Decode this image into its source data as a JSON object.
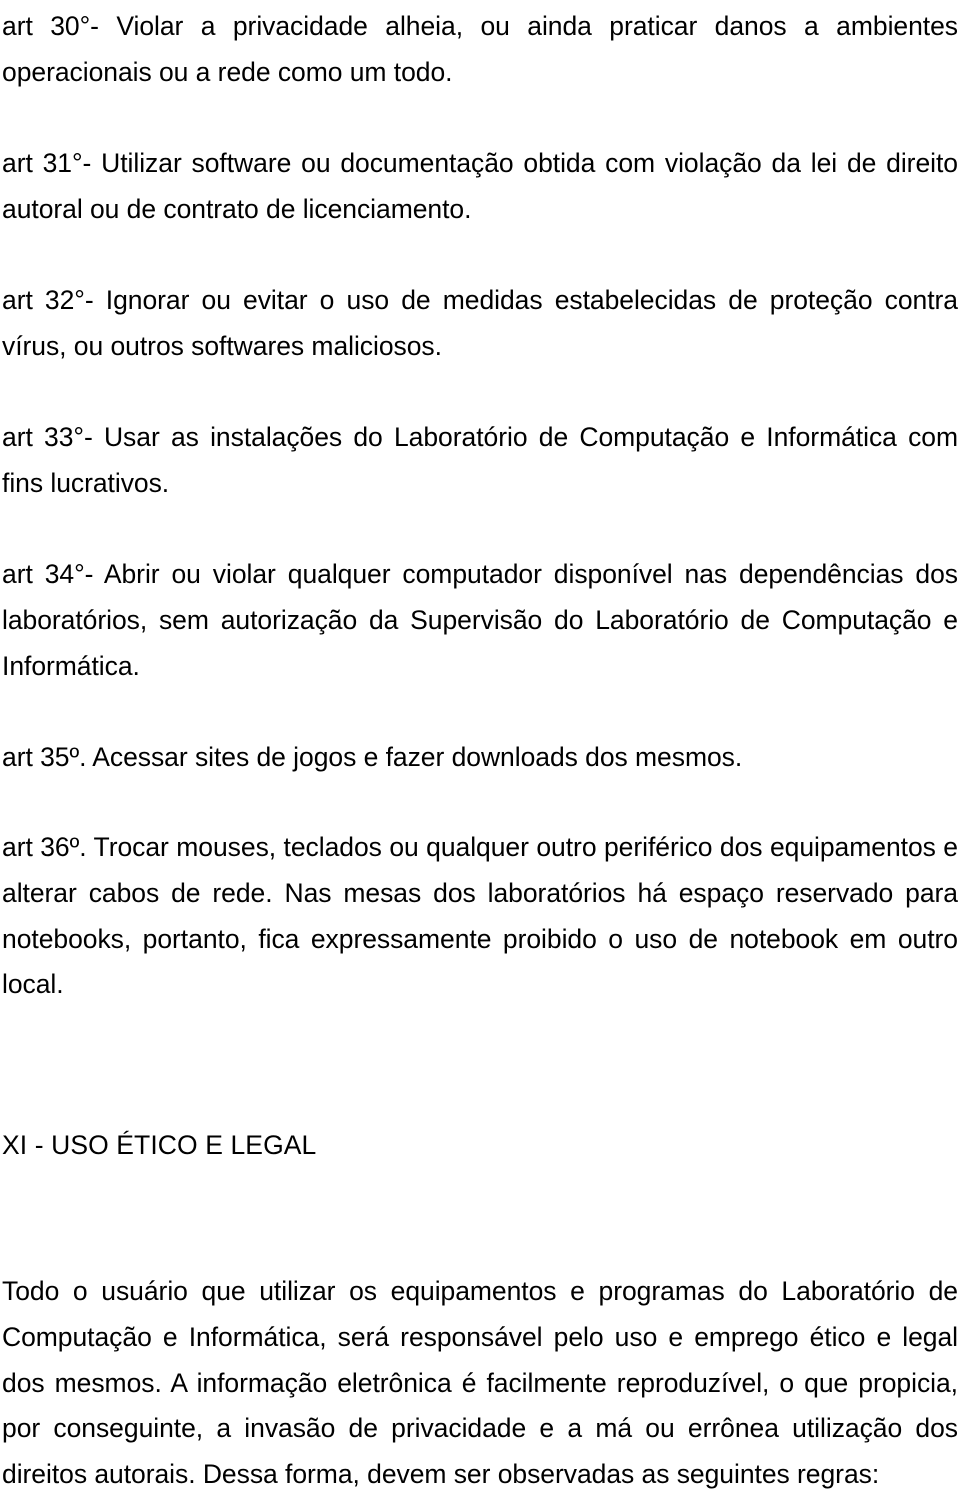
{
  "document": {
    "language": "pt-BR",
    "text_color": "#000000",
    "background_color": "#ffffff",
    "articles": [
      {
        "id": "art-30",
        "text": "art 30°- Violar a privacidade alheia, ou ainda praticar danos a ambientes operacionais ou a rede como um todo."
      },
      {
        "id": "art-31",
        "text": "art 31°- Utilizar software ou documentação obtida com violação da lei de direito autoral ou de contrato de licenciamento."
      },
      {
        "id": "art-32",
        "text": "art 32°- Ignorar ou evitar o uso de medidas estabelecidas de proteção contra vírus, ou outros softwares maliciosos."
      },
      {
        "id": "art-33",
        "text": "art 33°- Usar as instalações do Laboratório de Computação e Informática com fins lucrativos."
      },
      {
        "id": "art-34",
        "text": "art 34°- Abrir ou violar qualquer computador disponível nas dependências dos laboratórios, sem autorização da Supervisão do Laboratório de Computação e Informática."
      },
      {
        "id": "art-35",
        "text": "art 35º. Acessar sites de jogos e fazer downloads dos mesmos."
      },
      {
        "id": "art-36",
        "text": "art 36º. Trocar mouses, teclados ou qualquer outro periférico dos equipamentos e alterar cabos de rede. Nas mesas dos laboratórios há espaço reservado para notebooks, portanto, fica expressamente proibido o uso de notebook em outro local."
      }
    ],
    "section": {
      "id": "section-xi",
      "heading": "XI - USO ÉTICO E LEGAL",
      "body": "Todo o usuário que utilizar os equipamentos e programas do Laboratório de Computação e Informática, será responsável pelo uso e emprego ético e legal dos mesmos. A informação eletrônica é facilmente reproduzível, o que propicia, por conseguinte, a invasão de privacidade e a má ou errônea utilização dos direitos autorais. Dessa forma, devem ser observadas as seguintes regras:"
    }
  }
}
